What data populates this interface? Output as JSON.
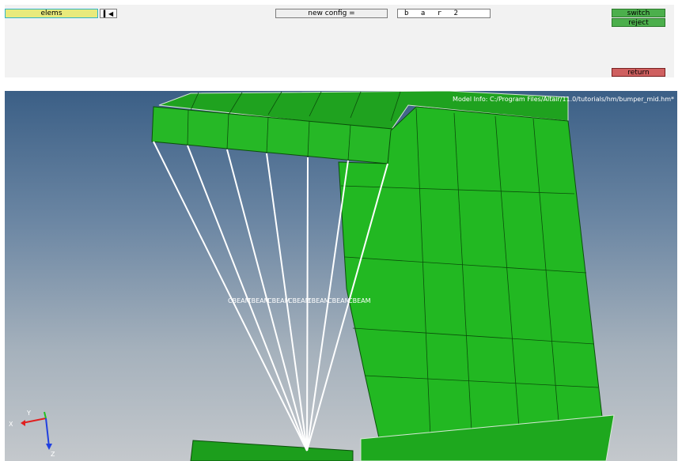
{
  "panel": {
    "entity_selector": "elems",
    "reverse_icon": "skip-back-icon",
    "config_selector": "new config =",
    "name_value": "b a r 2",
    "switch_label": "switch",
    "reject_label": "reject",
    "return_label": "return"
  },
  "viewport": {
    "model_info": "Model Info: C:/Program Files/Altair/11.0/tutorials/hm/bumper_mid.hm*",
    "beam_labels": [
      "CBEAM",
      "CBEAM",
      "CBEAM",
      "CBEAM",
      "CBEAM",
      "CBEAM",
      "CBEAM"
    ],
    "axis": {
      "x": "X",
      "y": "Y",
      "z": "Z"
    }
  },
  "colors": {
    "mesh_green": "#22bb22",
    "mesh_edge": "#0b4f0b",
    "entity_button": "#e8ea7c",
    "switch_button": "#4caf4c",
    "return_button": "#cf6060"
  }
}
